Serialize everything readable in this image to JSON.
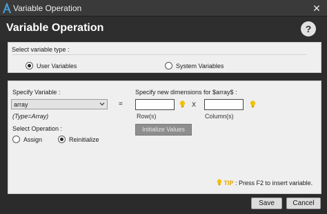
{
  "window": {
    "title": "Variable Operation",
    "close_glyph": "✕",
    "logo_icon": "app-logo-icon"
  },
  "header": {
    "title": "Variable Operation",
    "help_label": "?"
  },
  "variable_type": {
    "label": "Select variable type :",
    "options": [
      "User Variables",
      "System Variables"
    ],
    "selected": "User Variables"
  },
  "specify_variable": {
    "label": "Specify Variable :",
    "value": "array",
    "type_hint": "(Type=Array)"
  },
  "dimensions": {
    "label": "Specify new dimensions for $array$ :",
    "equals": "=",
    "separator": "X",
    "row_label": "Row(s)",
    "column_label": "Column(s)",
    "row_value": "",
    "column_value": "",
    "init_button": "Initialize Values"
  },
  "operation": {
    "label": "Select Operation :",
    "options": [
      "Assign",
      "Reinitialize"
    ],
    "selected": "Reinitialize"
  },
  "tip": {
    "label": "TIP",
    "text": ":  Press F2 to insert variable."
  },
  "footer": {
    "save_label": "Save",
    "cancel_label": "Cancel"
  },
  "colors": {
    "titlebar": "#3a3a3a",
    "header": "#2e2e2e",
    "panel": "#efefef",
    "tip_accent": "#e6a400",
    "bulb": "#f2c200"
  }
}
